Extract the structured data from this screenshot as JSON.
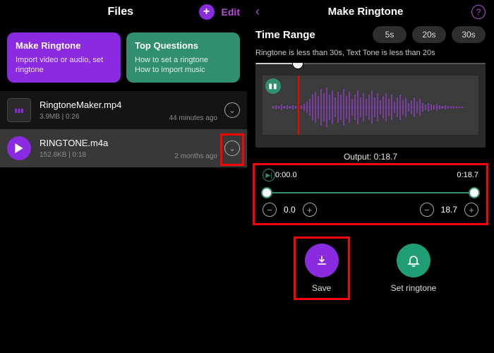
{
  "left": {
    "title": "Files",
    "edit_label": "Edit",
    "card_ringtone": {
      "title": "Make Ringtone",
      "sub": "Import video or audio, set ringtone"
    },
    "card_questions": {
      "title": "Top Questions",
      "sub1": "How to set a ringtone",
      "sub2": "How to import music"
    },
    "rows": [
      {
        "name": "RingtoneMaker.mp4",
        "meta": "3.9MB | 0:26",
        "ago": "44 minutes ago"
      },
      {
        "name": "RINGTONE.m4a",
        "meta": "152.8KB | 0:18",
        "ago": "2 months ago"
      }
    ]
  },
  "right": {
    "title": "Make Ringtone",
    "time_range_label": "Time Range",
    "chips": [
      "5s",
      "20s",
      "30s"
    ],
    "hint": "Ringtone is less than 30s, Text Tone is less than 20s",
    "output_label": "Output: 0:18.7",
    "trim": {
      "start_time": "0:00.0",
      "end_time": "0:18.7",
      "start_val": "0.0",
      "end_val": "18.7"
    },
    "actions": {
      "save": "Save",
      "set": "Set ringtone"
    }
  }
}
